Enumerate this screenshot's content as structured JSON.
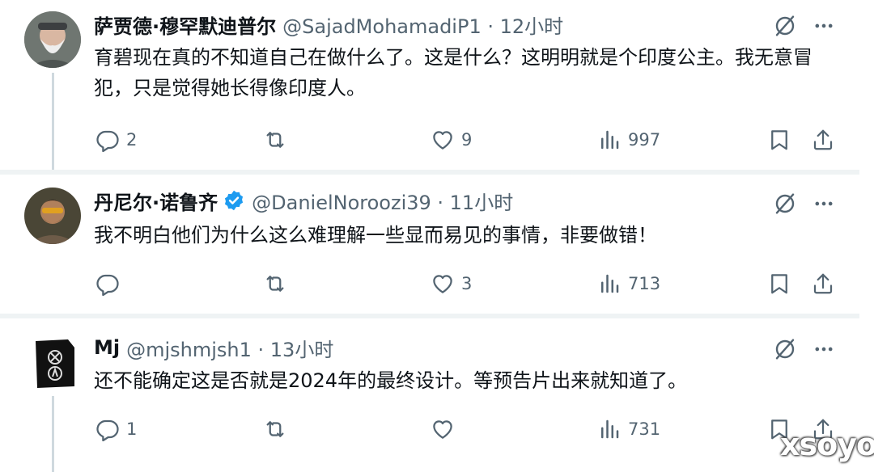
{
  "tweets": [
    {
      "display_name": "萨贾德·穆罕默迪普尔",
      "handle_time": "@SajadMohamadiP1 · 12小时",
      "text": "育碧现在真的不知道自己在做什么了。这是什么？这明明就是个印度公主。我无意冒犯，只是觉得她长得像印度人。",
      "replies": "2",
      "retweets": "",
      "likes": "9",
      "views": "997"
    },
    {
      "display_name": "丹尼尔·诺鲁齐",
      "handle_time": "@DanielNoroozi39 · 11小时",
      "text": "我不明白他们为什么这么难理解一些显而易见的事情，非要做错！",
      "replies": "",
      "retweets": "",
      "likes": "3",
      "views": "713"
    },
    {
      "display_name": "Mj",
      "handle_time": "@mjshmjsh1 · 13小时",
      "text": "还不能确定这是否就是2024年的最终设计。等预告片出来就知道了。",
      "replies": "1",
      "retweets": "",
      "likes": "",
      "views": "731"
    }
  ],
  "colors": {
    "text": "#0f1419",
    "muted": "#536471",
    "verified": "#1d9bf0",
    "divider": "#eff3f4"
  },
  "icons": [
    "reply-icon",
    "retweet-icon",
    "like-icon",
    "views-icon",
    "bookmark-icon",
    "share-icon",
    "grok-icon",
    "more-icon",
    "verified-badge-icon"
  ],
  "watermark": "xsoyo"
}
